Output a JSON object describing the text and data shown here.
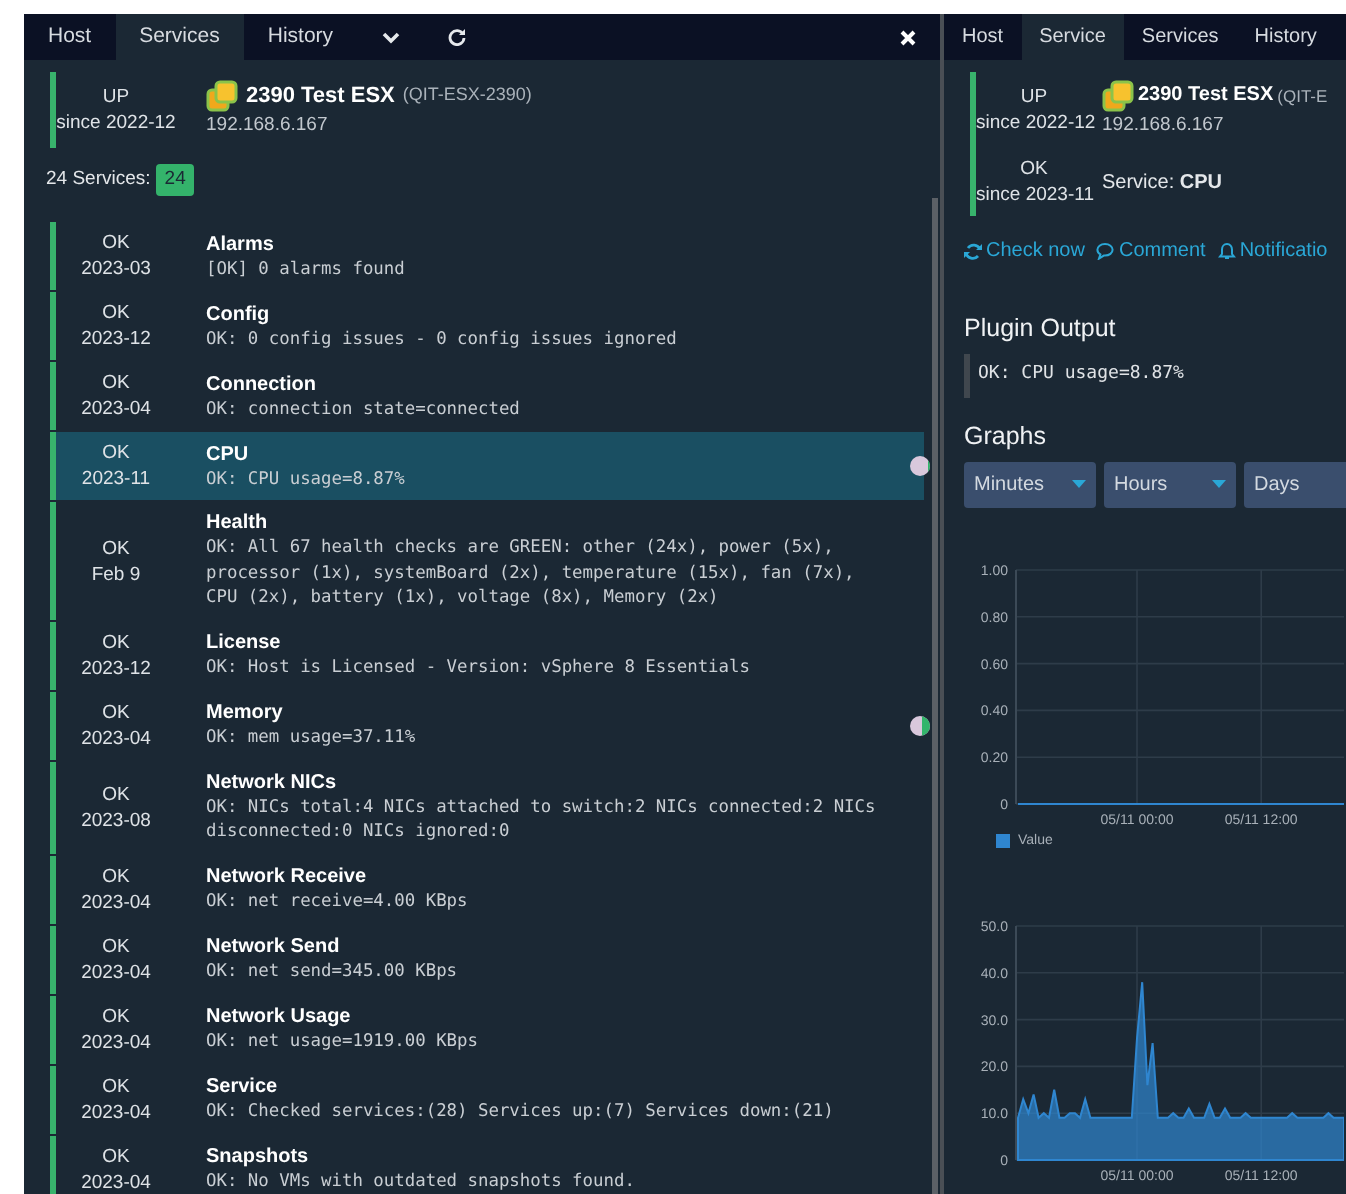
{
  "left_panel": {
    "tabs": [
      {
        "label": "Host",
        "selected": false
      },
      {
        "label": "Services",
        "selected": true
      },
      {
        "label": "History",
        "selected": false
      }
    ],
    "host": {
      "state": "UP",
      "since": "since 2022-12",
      "name": "2390 Test ESX",
      "alias": "(QIT-ESX-2390)",
      "address": "192.168.6.167"
    },
    "services_label": "24 Services:",
    "services_badge": "24",
    "services": [
      {
        "state": "OK",
        "since": "2023-03",
        "name": "Alarms",
        "output": "[OK] 0 alarms found",
        "selected": false
      },
      {
        "state": "OK",
        "since": "2023-12",
        "name": "Config",
        "output": "OK: 0 config issues - 0 config issues ignored",
        "selected": false
      },
      {
        "state": "OK",
        "since": "2023-04",
        "name": "Connection",
        "output": "OK: connection state=connected",
        "selected": false
      },
      {
        "state": "OK",
        "since": "2023-11",
        "name": "CPU",
        "output": "OK: CPU usage=8.87%",
        "selected": true,
        "level": 0.09
      },
      {
        "state": "OK",
        "since": "Feb 9",
        "name": "Health",
        "output": "OK: All 67 health checks are GREEN: other (24x), power (5x), processor (1x), systemBoard (2x), temperature (15x), fan (7x), CPU (2x), battery (1x), voltage (8x), Memory (2x)",
        "selected": false
      },
      {
        "state": "OK",
        "since": "2023-12",
        "name": "License",
        "output": "OK: Host is Licensed - Version: vSphere 8 Essentials",
        "selected": false
      },
      {
        "state": "OK",
        "since": "2023-04",
        "name": "Memory",
        "output": "OK: mem usage=37.11%",
        "selected": false,
        "level": 0.37
      },
      {
        "state": "OK",
        "since": "2023-08",
        "name": "Network NICs",
        "output": "OK: NICs total:4 NICs attached to switch:2 NICs connected:2 NICs disconnected:0 NICs ignored:0",
        "selected": false
      },
      {
        "state": "OK",
        "since": "2023-04",
        "name": "Network Receive",
        "output": "OK: net receive=4.00 KBps",
        "selected": false
      },
      {
        "state": "OK",
        "since": "2023-04",
        "name": "Network Send",
        "output": "OK: net send=345.00 KBps",
        "selected": false
      },
      {
        "state": "OK",
        "since": "2023-04",
        "name": "Network Usage",
        "output": "OK: net usage=1919.00 KBps",
        "selected": false
      },
      {
        "state": "OK",
        "since": "2023-04",
        "name": "Service",
        "output": "OK: Checked services:(28) Services up:(7) Services down:(21)",
        "selected": false
      },
      {
        "state": "OK",
        "since": "2023-04",
        "name": "Snapshots",
        "output": "OK: No VMs with outdated snapshots found.",
        "selected": false
      }
    ]
  },
  "right_panel": {
    "tabs": [
      {
        "label": "Host",
        "selected": false
      },
      {
        "label": "Service",
        "selected": true
      },
      {
        "label": "Services",
        "selected": false
      },
      {
        "label": "History",
        "selected": false
      }
    ],
    "host": {
      "state": "UP",
      "since": "since 2022-12",
      "name": "2390 Test ESX",
      "alias": "(QIT-E",
      "address": "192.168.6.167"
    },
    "service": {
      "state": "OK",
      "since": "since 2023-11",
      "label": "Service: **CPU**"
    },
    "actions": [
      {
        "kind": "sync",
        "label": "Check now"
      },
      {
        "kind": "comment",
        "label": "Comment"
      },
      {
        "kind": "bell",
        "label": "Notificatio"
      }
    ],
    "plugin_output": {
      "heading": "Plugin Output",
      "text": "OK: CPU usage=8.87%"
    },
    "graphs": {
      "heading": "Graphs",
      "ranges": [
        {
          "label": "Minutes"
        },
        {
          "label": "Hours"
        },
        {
          "label": "Days"
        }
      ],
      "charts": [
        {
          "chart_data": {
            "type": "line",
            "grid": true,
            "ylim": [
              0,
              1
            ],
            "categories": [
              null,
              null,
              null,
              null,
              null,
              null,
              null,
              null,
              null,
              null,
              null,
              null,
              null,
              null,
              null,
              null,
              null,
              null,
              null,
              null,
              null,
              null,
              null,
              "05/11 00:00",
              null,
              null,
              null,
              null,
              null,
              null,
              null,
              null,
              null,
              null,
              null,
              null,
              null,
              null,
              null,
              null,
              null,
              null,
              null,
              null,
              null,
              null,
              null,
              "05/11 12:00",
              null,
              null,
              null,
              null,
              null,
              null,
              null,
              null,
              null,
              null,
              null,
              null,
              null,
              null,
              null,
              null
            ],
            "yticks": [
              {
                "value": 0,
                "label": "0"
              },
              {
                "value": 0.2,
                "label": "0.20"
              },
              {
                "value": 0.4,
                "label": "0.40"
              },
              {
                "value": 0.6,
                "label": "0.60"
              },
              {
                "value": 0.8,
                "label": "0.80"
              },
              {
                "value": 1,
                "label": "1.00"
              }
            ],
            "series": [
              {
                "name": "Value",
                "color": "#2f86d0",
                "values": [
                  0,
                  0,
                  0,
                  0,
                  0,
                  0,
                  0,
                  0,
                  0,
                  0,
                  0,
                  0,
                  0,
                  0,
                  0,
                  0,
                  0,
                  0,
                  0,
                  0,
                  0,
                  0,
                  0,
                  0,
                  0,
                  0,
                  0,
                  0,
                  0,
                  0,
                  0,
                  0,
                  0,
                  0,
                  0,
                  0,
                  0,
                  0,
                  0,
                  0,
                  0,
                  0,
                  0,
                  0,
                  0,
                  0,
                  0,
                  0,
                  0,
                  0,
                  0,
                  0,
                  0,
                  0,
                  0,
                  0,
                  0,
                  0,
                  0,
                  0,
                  0,
                  0,
                  0,
                  0
                ]
              }
            ]
          }
        },
        {
          "chart_data": {
            "type": "area",
            "grid": true,
            "ylim": [
              0,
              50
            ],
            "categories": [
              null,
              null,
              null,
              null,
              null,
              null,
              null,
              null,
              null,
              null,
              null,
              null,
              null,
              null,
              null,
              null,
              null,
              null,
              null,
              null,
              null,
              null,
              null,
              "05/11 00:00",
              null,
              null,
              null,
              null,
              null,
              null,
              null,
              null,
              null,
              null,
              null,
              null,
              null,
              null,
              null,
              null,
              null,
              null,
              null,
              null,
              null,
              null,
              null,
              "05/11 12:00",
              null,
              null,
              null,
              null,
              null,
              null,
              null,
              null,
              null,
              null,
              null,
              null,
              null,
              null,
              null,
              null
            ],
            "yticks": [
              {
                "value": 0,
                "label": "0"
              },
              {
                "value": 10,
                "label": "10.0"
              },
              {
                "value": 20,
                "label": "20.0"
              },
              {
                "value": 30,
                "label": "30.0"
              },
              {
                "value": 40,
                "label": "40.0"
              },
              {
                "value": 50,
                "label": "50.0"
              }
            ],
            "series": [
              {
                "color": "#2f86d0",
                "values": [
                  9,
                  13,
                  10,
                  14,
                  9,
                  10,
                  9,
                  15,
                  9,
                  9,
                  10,
                  10,
                  9,
                  13,
                  9,
                  9,
                  9,
                  9,
                  9,
                  9,
                  9,
                  9,
                  9,
                  26,
                  38,
                  16,
                  25,
                  9,
                  9,
                  9,
                  10,
                  9,
                  9,
                  11,
                  9,
                  9,
                  9,
                  12,
                  9,
                  9,
                  11,
                  9,
                  9,
                  9,
                  10,
                  9,
                  9,
                  9,
                  9,
                  9,
                  9,
                  9,
                  9,
                  10,
                  9,
                  9,
                  9,
                  9,
                  9,
                  9,
                  10,
                  9,
                  9,
                  9
                ]
              }
            ]
          }
        }
      ]
    }
  }
}
